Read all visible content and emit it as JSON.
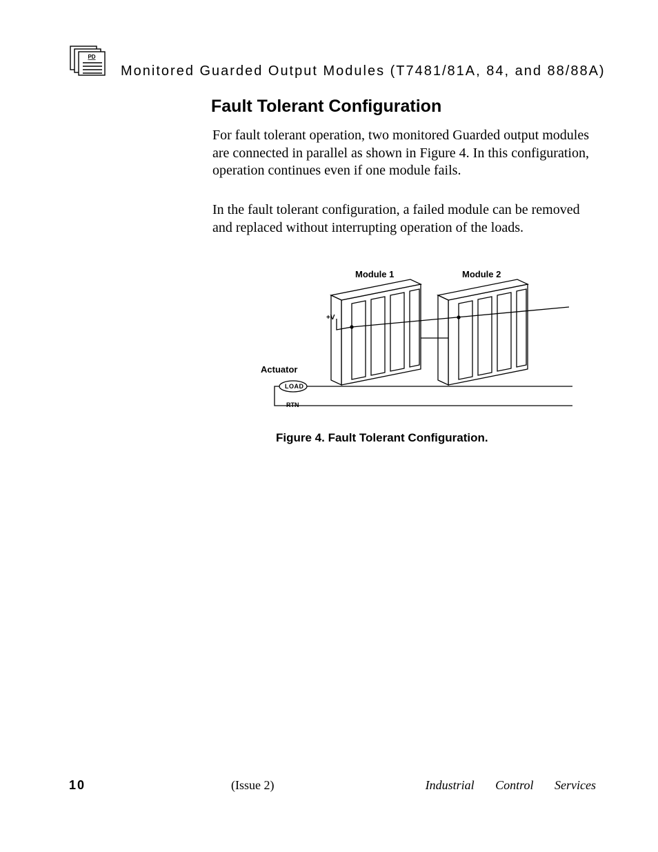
{
  "header": {
    "icon_label": "PD",
    "title": "Monitored Guarded Output Modules (T7481/81A,  84, and 88/88A)"
  },
  "section": {
    "heading": "Fault Tolerant Configuration",
    "para1": "For fault tolerant operation, two monitored Guarded output modules are connected in parallel as shown in Figure 4.  In this configuration, operation continues even if one module fails.",
    "para2": "In the fault tolerant configuration, a failed module can be removed and replaced without interrupting operation of the loads."
  },
  "figure": {
    "module1_label": "Module 1",
    "module2_label": "Module 2",
    "actuator_label": "Actuator",
    "plus_v_label": "+V",
    "load_label": "LOAD",
    "rtn_label": "RTN",
    "caption": "Figure 4.  Fault Tolerant Configuration."
  },
  "footer": {
    "page_number": "10",
    "issue": "(Issue 2)",
    "right": "Industrial Control Services"
  }
}
